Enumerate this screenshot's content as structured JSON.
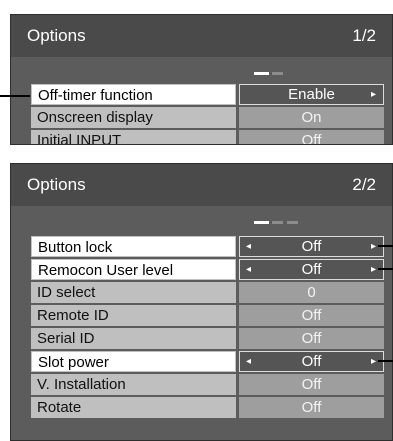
{
  "panels": [
    {
      "title": "Options",
      "page": "1/2",
      "rows": [
        {
          "label": "Off-timer function",
          "value": "Enable",
          "arrow_right": "▸"
        },
        {
          "label": "Onscreen display",
          "value": "On"
        },
        {
          "label": "Initial INPUT",
          "value": "Off"
        }
      ]
    },
    {
      "title": "Options",
      "page": "2/2",
      "rows": [
        {
          "label": "Button lock",
          "value": "Off",
          "arrow_left": "◂",
          "arrow_right": "▸"
        },
        {
          "label": "Remocon User level",
          "value": "Off",
          "arrow_left": "◂",
          "arrow_right": "▸"
        },
        {
          "label": "ID select",
          "value": "0"
        },
        {
          "label": "Remote ID",
          "value": "Off"
        },
        {
          "label": "Serial ID",
          "value": "Off"
        },
        {
          "label": "Slot power",
          "value": "Off",
          "arrow_left": "◂",
          "arrow_right": "▸"
        },
        {
          "label": "V. Installation",
          "value": "Off"
        },
        {
          "label": "Rotate",
          "value": "Off"
        }
      ]
    }
  ],
  "colors": {
    "panel_bg": "#5c5c5c",
    "title_bg": "#4a4a4a",
    "label_bg": "#bfbfbf",
    "value_bg": "#9e9e9e",
    "selected_value_bg": "#555555"
  }
}
